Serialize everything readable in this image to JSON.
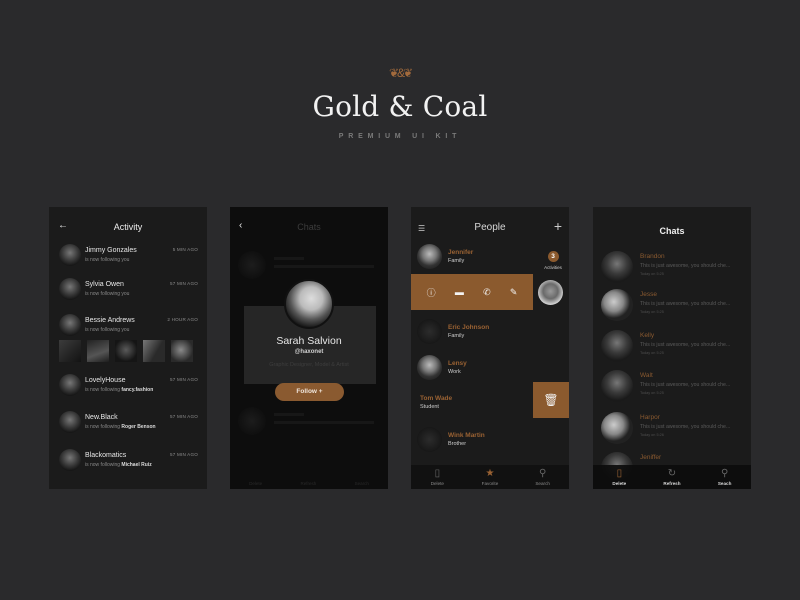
{
  "header": {
    "ornament": "❦&❦",
    "title": "Gold & Coal",
    "subtitle": "PREMIUM UI KIT"
  },
  "colors": {
    "gold": "#8b5a2e",
    "background": "#2a2a2c",
    "screen": "#1b1b1b"
  },
  "activity_screen": {
    "title": "Activity",
    "back_icon": "←",
    "items": [
      {
        "name": "Jimmy Gonzales",
        "action": "is now following you",
        "target": "",
        "time": "5 MIN AGO"
      },
      {
        "name": "Sylvia Owen",
        "action": "is now following you",
        "target": "",
        "time": "57 MIN AGO"
      },
      {
        "name": "Bessie Andrews",
        "action": "is now following you",
        "target": "",
        "time": "2 HOUR AGO"
      },
      {
        "name": "LovelyHouse",
        "action": "is now following",
        "target": "fancy.fashion",
        "time": "57 MIN AGO"
      },
      {
        "name": "New.Black",
        "action": "is now following",
        "target": "Roger Benson",
        "time": "57 MIN AGO"
      },
      {
        "name": "Blackomatics",
        "action": "is now following",
        "target": "Michael Ruiz",
        "time": "57 MIN AGO"
      }
    ]
  },
  "profile_screen": {
    "background_title": "Chats",
    "back_icon": "‹",
    "name": "Sarah Salvion",
    "handle": "@haxonet",
    "bio": "Graphic Designer, Model & Artist",
    "follow_label": "Follow  +",
    "tabs": [
      "Delete",
      "Refresh",
      "Search"
    ]
  },
  "people_screen": {
    "title": "People",
    "menu_icon": "☰",
    "add_icon": "+",
    "activities_count": "3",
    "activities_label": "Activities",
    "people": [
      {
        "name": "Jennifer",
        "relation": "Family"
      },
      {
        "name": "Eric Johnson",
        "relation": "Family"
      },
      {
        "name": "Lensy",
        "relation": "Work"
      },
      {
        "name": "Tom Wade",
        "relation": "Student"
      },
      {
        "name": "Wink Martin",
        "relation": "Brother"
      }
    ],
    "actions": {
      "info": "ⓘ",
      "video": "▬",
      "call": "✆",
      "edit": "✎"
    },
    "delete_icon": "🗑",
    "tabs": [
      {
        "icon": "▯",
        "label": "Delete"
      },
      {
        "icon": "★",
        "label": "Favorite"
      },
      {
        "icon": "⚲",
        "label": "Search"
      }
    ]
  },
  "chats_screen": {
    "title": "Chats",
    "chats": [
      {
        "name": "Brandon",
        "message": "This is just awesome, you should che...",
        "time": "Today on 5:25"
      },
      {
        "name": "Jesse",
        "message": "This is just awesome, you should che...",
        "time": "Today on 5:25"
      },
      {
        "name": "Kelly",
        "message": "This is just awesome, you should che...",
        "time": "Today on 5:25"
      },
      {
        "name": "Walt",
        "message": "This is just awesome, you should che...",
        "time": "Today on 5:25"
      },
      {
        "name": "Harpor",
        "message": "This is just awesome, you should che...",
        "time": "Today on 5:26"
      },
      {
        "name": "Jeniffer",
        "message": "",
        "time": ""
      }
    ],
    "tabs": [
      {
        "icon": "▯",
        "label": "Delete"
      },
      {
        "icon": "↻",
        "label": "Refresh"
      },
      {
        "icon": "⚲",
        "label": "Seach"
      }
    ]
  }
}
